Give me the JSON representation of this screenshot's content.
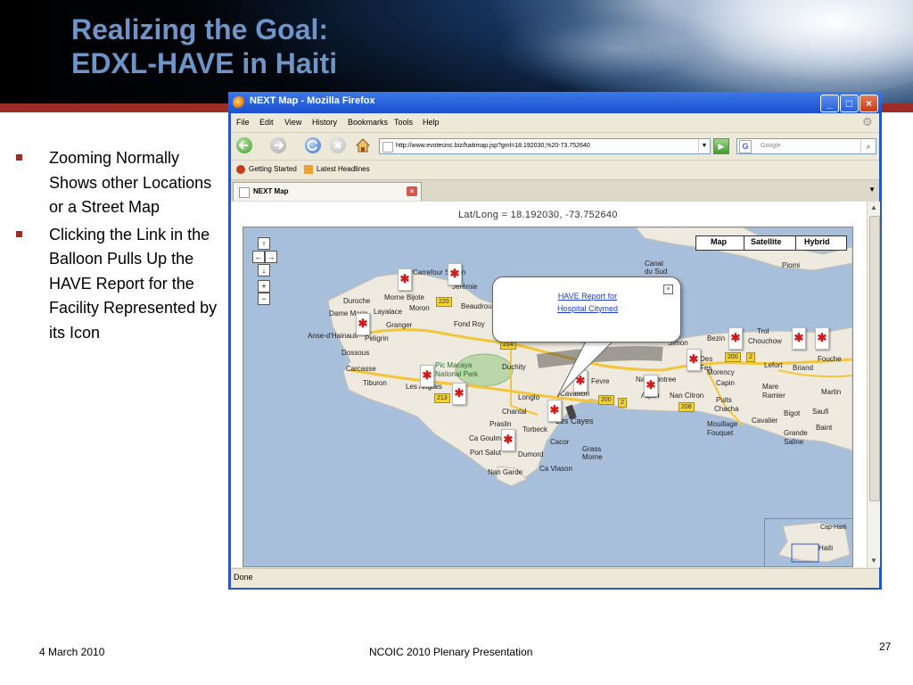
{
  "slide": {
    "title_line1": "Realizing the Goal:",
    "title_line2": "EDXL-HAVE in Haiti",
    "bullets": [
      "Zooming Normally Shows other Locations or a Street Map",
      "Clicking the Link in the Balloon Pulls Up the HAVE Report for the Facility Represented by its Icon"
    ],
    "footer_date": "4 March 2010",
    "footer_center": "NCOIC 2010 Plenary Presentation",
    "page_number": "27",
    "accent_color": "#9b2d25",
    "title_color": "#6f95c8"
  },
  "browser": {
    "window_title": "NEXT Map - Mozilla Firefox",
    "menu": [
      "File",
      "Edit",
      "View",
      "History",
      "Bookmarks",
      "Tools",
      "Help"
    ],
    "url": "http://www.evotecinc.biz/haitimap.jsp?gml=18.192030,%20-73.752640",
    "search_placeholder": "Google",
    "bookmarks": [
      "Getting Started",
      "Latest Headlines"
    ],
    "tab_label": "NEXT Map",
    "status": "Done",
    "icons": {
      "back": "back-arrow-icon",
      "forward": "forward-arrow-icon",
      "reload": "reload-icon",
      "stop": "stop-icon",
      "home": "home-icon",
      "go": "go-arrow-icon",
      "search": "magnifier-icon"
    }
  },
  "map_page": {
    "latlong_label": "Lat/Long = 18.192030, -73.752640",
    "map_types": [
      "Map",
      "Satellite",
      "Hybrid"
    ],
    "controls": [
      "↑",
      "←",
      "→",
      "↓",
      "+",
      "−"
    ],
    "balloon_link_line1": "HAVE Report for",
    "balloon_link_line2": "Hospital Citymed",
    "balloon_close": "×",
    "places": [
      "Carrefour Sanon",
      "Jérémie",
      "Canal du Sud",
      "Morne Bijote",
      "Duroche",
      "Dame Marie",
      "Layalace",
      "Moron",
      "Beaudrou",
      "Anse-d'Hainault",
      "Peligrin",
      "Granger",
      "Fond Roy",
      "Dossous",
      "Carcasse",
      "Tiburon",
      "Les Anglais",
      "Duchity",
      "Pic Macaya National Park",
      "Chantal",
      "Longlo",
      "Cavaillon",
      "Fevre",
      "Les Cayes",
      "Praslin",
      "Torbeck",
      "Ca Goulm",
      "Port Salut",
      "Dumord",
      "Nan Garde",
      "Cacor",
      "Grass Morne",
      "Ca Vlason",
      "Nan Contree",
      "Aquin",
      "Nan Citron",
      "Puits",
      "Chacha",
      "Mouillage Fouquet",
      "Simon",
      "Bezin",
      "Trol",
      "Chouchow",
      "Lefort",
      "Briand",
      "Fouche",
      "Mare Ramier",
      "Martin",
      "Bigot",
      "Saufi",
      "Cavalier",
      "Baint",
      "Grande Saline",
      "Capin",
      "Morency",
      "Des Fes",
      "Piomi",
      "Haiti",
      "Cap-Haïti"
    ],
    "route_shields": [
      "220",
      "214",
      "213",
      "200",
      "2",
      "208",
      "200",
      "2"
    ],
    "overview_label": "Haiti"
  }
}
